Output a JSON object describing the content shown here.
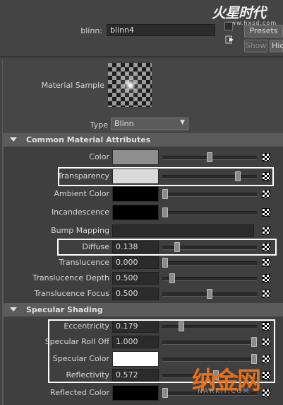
{
  "header": {
    "node_label": "blinn:",
    "node_name": "blinn4",
    "presets_label": "Presets",
    "show_label": "Show",
    "hide_label": "Hid"
  },
  "material_sample": {
    "label": "Material Sample"
  },
  "type": {
    "label": "Type",
    "value": "Blinn"
  },
  "common": {
    "title": "Common Material Attributes",
    "rows": [
      {
        "label": "Color",
        "kind": "swatch",
        "swatch_color": "#8e8e8e",
        "slider_fraction": 0.5
      },
      {
        "label": "Transparency",
        "kind": "swatch",
        "swatch_color": "#d9d9d9",
        "slider_fraction": 0.82
      },
      {
        "label": "Ambient Color",
        "kind": "swatch",
        "swatch_color": "#000000",
        "slider_fraction": 0.0
      },
      {
        "label": "Incandescence",
        "kind": "swatch",
        "swatch_color": "#000000",
        "slider_fraction": 0.0
      },
      {
        "label": "Bump Mapping",
        "kind": "bump"
      },
      {
        "label": "Diffuse",
        "kind": "number",
        "value": "0.138",
        "slider_fraction": 0.138
      },
      {
        "label": "Translucence",
        "kind": "number",
        "value": "0.000",
        "slider_fraction": 0.0
      },
      {
        "label": "Translucence Depth",
        "kind": "number",
        "value": "0.500",
        "slider_fraction": 0.08
      },
      {
        "label": "Translucence Focus",
        "kind": "number",
        "value": "0.500",
        "slider_fraction": 0.5
      }
    ]
  },
  "specular": {
    "title": "Specular Shading",
    "rows": [
      {
        "label": "Eccentricity",
        "kind": "number",
        "value": "0.179",
        "slider_fraction": 0.179
      },
      {
        "label": "Specular Roll Off",
        "kind": "number",
        "value": "1.000",
        "slider_fraction": 1.0
      },
      {
        "label": "Specular Color",
        "kind": "swatch",
        "swatch_color": "#ffffff",
        "slider_fraction": 1.0
      },
      {
        "label": "Reflectivity",
        "kind": "number",
        "value": "0.572",
        "slider_fraction": 0.572
      },
      {
        "label": "Reflected Color",
        "kind": "swatch",
        "swatch_color": "#000000",
        "slider_fraction": 0.0
      }
    ]
  },
  "watermarks": {
    "top_logo": "火星时代",
    "top_url": "www.hxsd.com",
    "bottom_logo": "纳金网",
    "bottom_url": "NARKII.COM"
  },
  "colors": {
    "background": "#444444",
    "highlight": "#ffffff",
    "watermark_orange": "#e8701a"
  }
}
